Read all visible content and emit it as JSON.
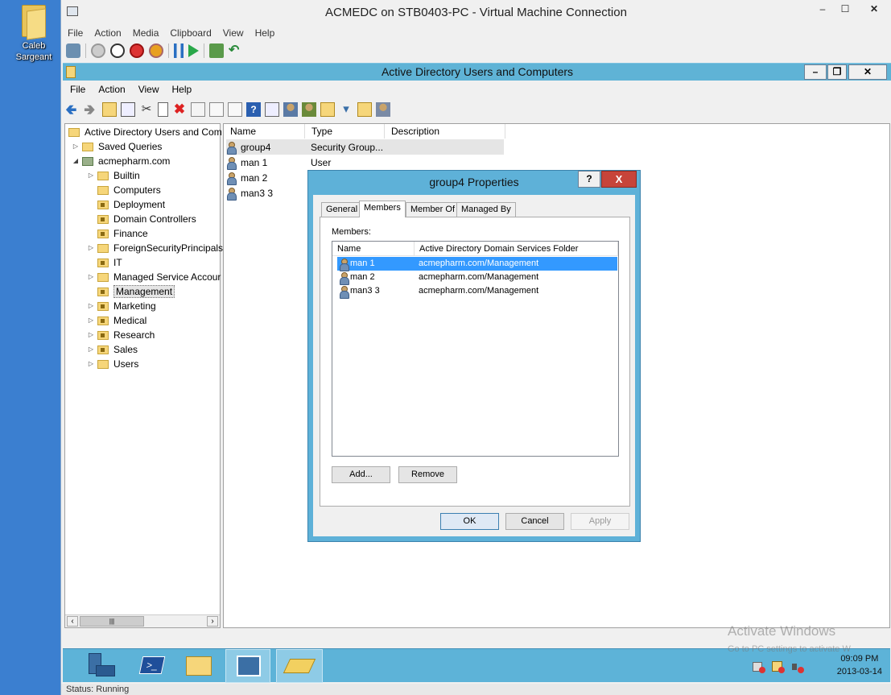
{
  "desktop": {
    "icon_label": "Caleb Sargeant"
  },
  "vm": {
    "title": "ACMEDC on STB0403-PC - Virtual Machine Connection",
    "menu": [
      "File",
      "Action",
      "Media",
      "Clipboard",
      "View",
      "Help"
    ],
    "status": "Status: Running"
  },
  "aduc": {
    "title": "Active Directory Users and Computers",
    "menu": [
      "File",
      "Action",
      "View",
      "Help"
    ],
    "tree": {
      "root": "Active Directory Users and Com",
      "saved_queries": "Saved Queries",
      "domain": "acmepharm.com",
      "items": [
        "Builtin",
        "Computers",
        "Deployment",
        "Domain Controllers",
        "Finance",
        "ForeignSecurityPrincipals",
        "IT",
        "Managed Service Accour",
        "Management",
        "Marketing",
        "Medical",
        "Research",
        "Sales",
        "Users"
      ],
      "selected": "Management"
    },
    "list": {
      "columns": [
        "Name",
        "Type",
        "Description"
      ],
      "rows": [
        {
          "name": "group4",
          "type": "Security Group..."
        },
        {
          "name": "man 1",
          "type": "User"
        },
        {
          "name": "man 2",
          "type": ""
        },
        {
          "name": "man3 3",
          "type": ""
        }
      ]
    }
  },
  "dialog": {
    "title": "group4 Properties",
    "help": "?",
    "close": "X",
    "tabs": [
      "General",
      "Members",
      "Member Of",
      "Managed By"
    ],
    "active_tab": "Members",
    "members_label": "Members:",
    "columns": [
      "Name",
      "Active Directory Domain Services Folder"
    ],
    "members": [
      {
        "name": "man 1",
        "folder": "acmepharm.com/Management"
      },
      {
        "name": "man 2",
        "folder": "acmepharm.com/Management"
      },
      {
        "name": "man3 3",
        "folder": "acmepharm.com/Management"
      }
    ],
    "add_label": "Add...",
    "remove_label": "Remove",
    "ok_label": "OK",
    "cancel_label": "Cancel",
    "apply_label": "Apply"
  },
  "taskbar": {
    "time": "09:09 PM",
    "date": "2013-03-14",
    "watermark_title": "Activate Windows",
    "watermark_sub": "Go to PC settings to activate W"
  }
}
